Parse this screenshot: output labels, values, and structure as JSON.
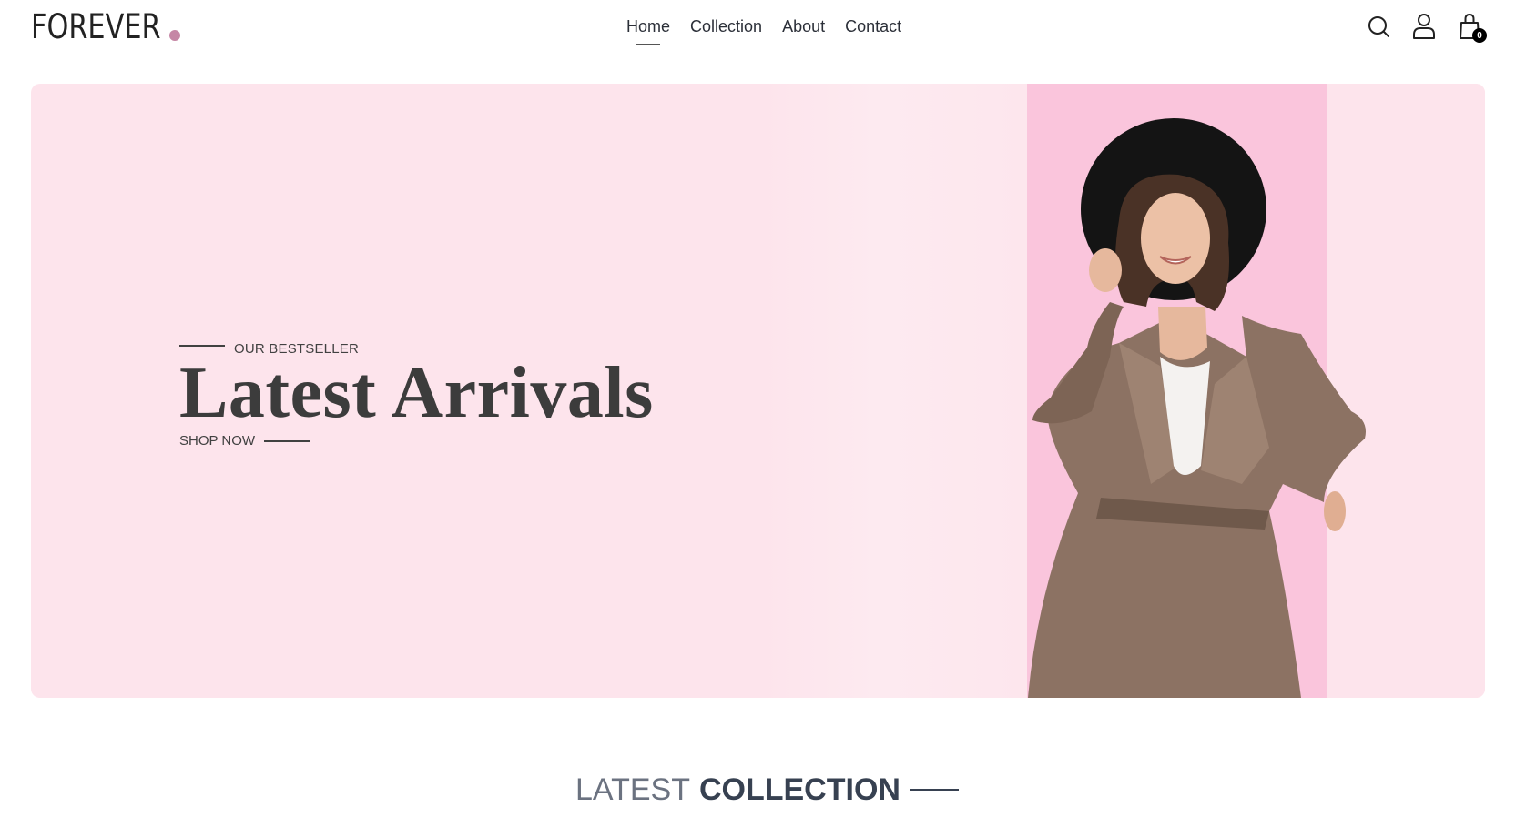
{
  "header": {
    "logo_text": "FOREVER",
    "logo_dot_color": "#c586a5",
    "nav": [
      {
        "label": "Home",
        "active": true
      },
      {
        "label": "Collection",
        "active": false
      },
      {
        "label": "About",
        "active": false
      },
      {
        "label": "Contact",
        "active": false
      }
    ],
    "icons": [
      "search-icon",
      "profile-icon",
      "cart-icon"
    ],
    "cart_count": "0"
  },
  "hero": {
    "eyebrow": "OUR BESTSELLER",
    "title": "Latest Arrivals",
    "cta": "SHOP NOW",
    "background_color": "#fde4ec",
    "stripe_color": "#fac5dc"
  },
  "latest_collection": {
    "title_light": "LATEST",
    "title_bold": "COLLECTION"
  }
}
